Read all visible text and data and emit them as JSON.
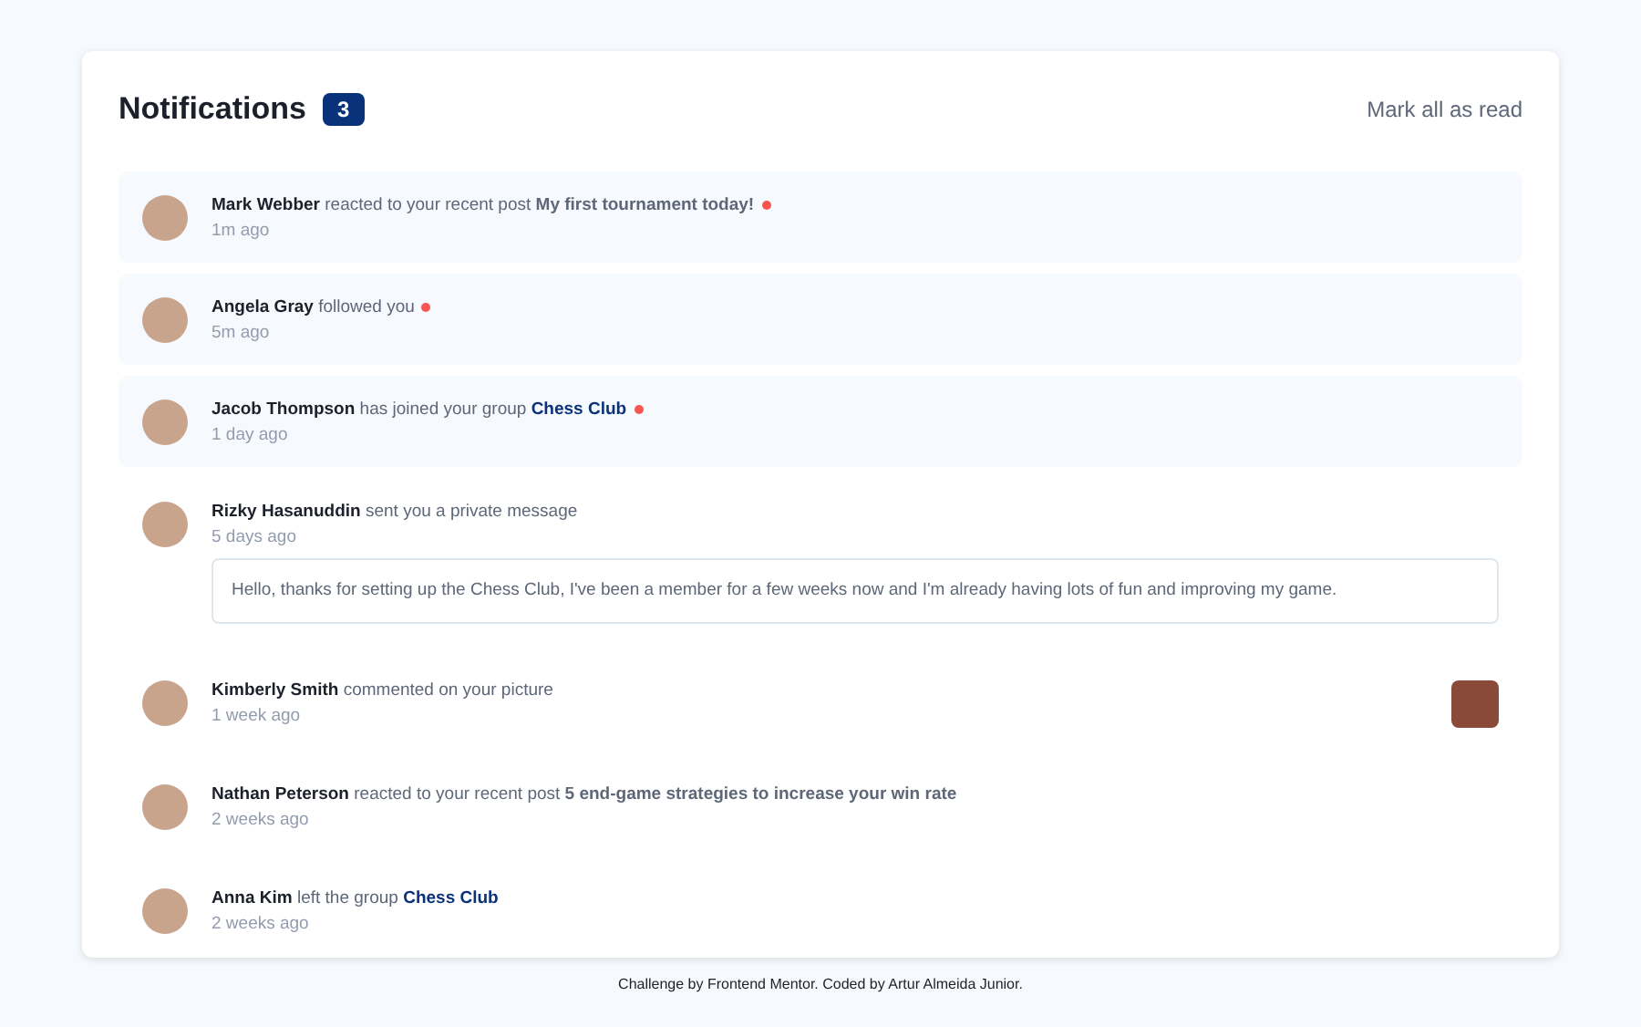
{
  "header": {
    "title": "Notifications",
    "unread_count": "3",
    "mark_all": "Mark all as read"
  },
  "notifications": [
    {
      "name": "Mark Webber",
      "action": "reacted to your recent post",
      "target": {
        "kind": "post",
        "text": "My first tournament today!"
      },
      "time": "1m ago",
      "unread": true
    },
    {
      "name": "Angela Gray",
      "action": "followed you",
      "time": "5m ago",
      "unread": true
    },
    {
      "name": "Jacob Thompson",
      "action": "has joined your group",
      "target": {
        "kind": "group",
        "text": "Chess Club"
      },
      "time": "1 day ago",
      "unread": true
    },
    {
      "name": "Rizky Hasanuddin",
      "action": "sent you a private message",
      "time": "5 days ago",
      "unread": false,
      "message": "Hello, thanks for setting up the Chess Club, I've been a member for a few weeks now and I'm already having lots of fun and improving my game."
    },
    {
      "name": "Kimberly Smith",
      "action": "commented on your picture",
      "time": "1 week ago",
      "unread": false,
      "picture": true
    },
    {
      "name": "Nathan Peterson",
      "action": "reacted to your recent post",
      "target": {
        "kind": "post",
        "text": "5 end-game strategies to increase your win rate"
      },
      "time": "2 weeks ago",
      "unread": false
    },
    {
      "name": "Anna Kim",
      "action": "left the group",
      "target": {
        "kind": "group",
        "text": "Chess Club"
      },
      "time": "2 weeks ago",
      "unread": false
    }
  ],
  "footer": "Challenge by Frontend Mentor. Coded by Artur Almeida Junior."
}
